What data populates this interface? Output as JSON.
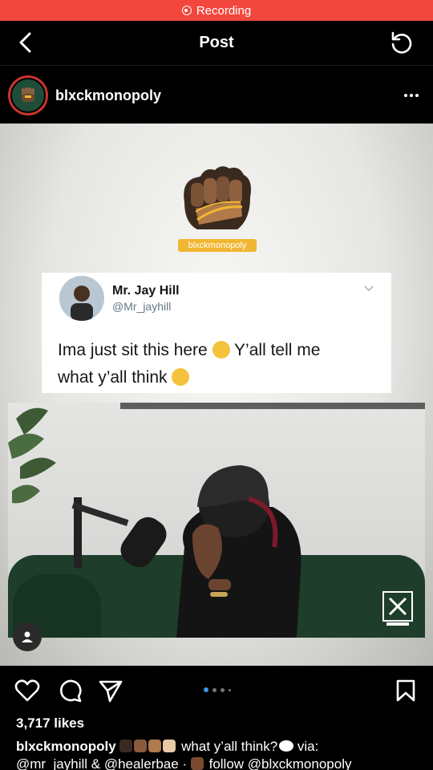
{
  "recording": {
    "label": "Recording"
  },
  "header": {
    "title": "Post"
  },
  "post": {
    "username": "blxckmonopoly",
    "logo_caption": "blxckmonopoly",
    "tweet": {
      "name": "Mr. Jay Hill",
      "handle": "@Mr_jayhill",
      "text_line1": "Ima just sit this here",
      "text_line1b": "Y’all tell me",
      "text_line2": "what y’all think"
    },
    "likes": "3,717 likes",
    "caption": {
      "username": "blxckmonopoly",
      "text1": "what y’all think?",
      "text2": "via:",
      "line2": "@mr_jayhill & @healerbae",
      "line2b": "follow @blxckmonopoly"
    },
    "carousel": {
      "count": 4,
      "active": 0
    }
  },
  "colors": {
    "recording_bar": "#f2473d",
    "accent_blue": "#3897f0",
    "logo_orange": "#f2b632"
  },
  "icons": [
    "back-arrow-icon",
    "refresh-icon",
    "more-icon",
    "heart-icon",
    "comment-icon",
    "share-icon",
    "bookmark-icon",
    "user-tag-icon"
  ]
}
